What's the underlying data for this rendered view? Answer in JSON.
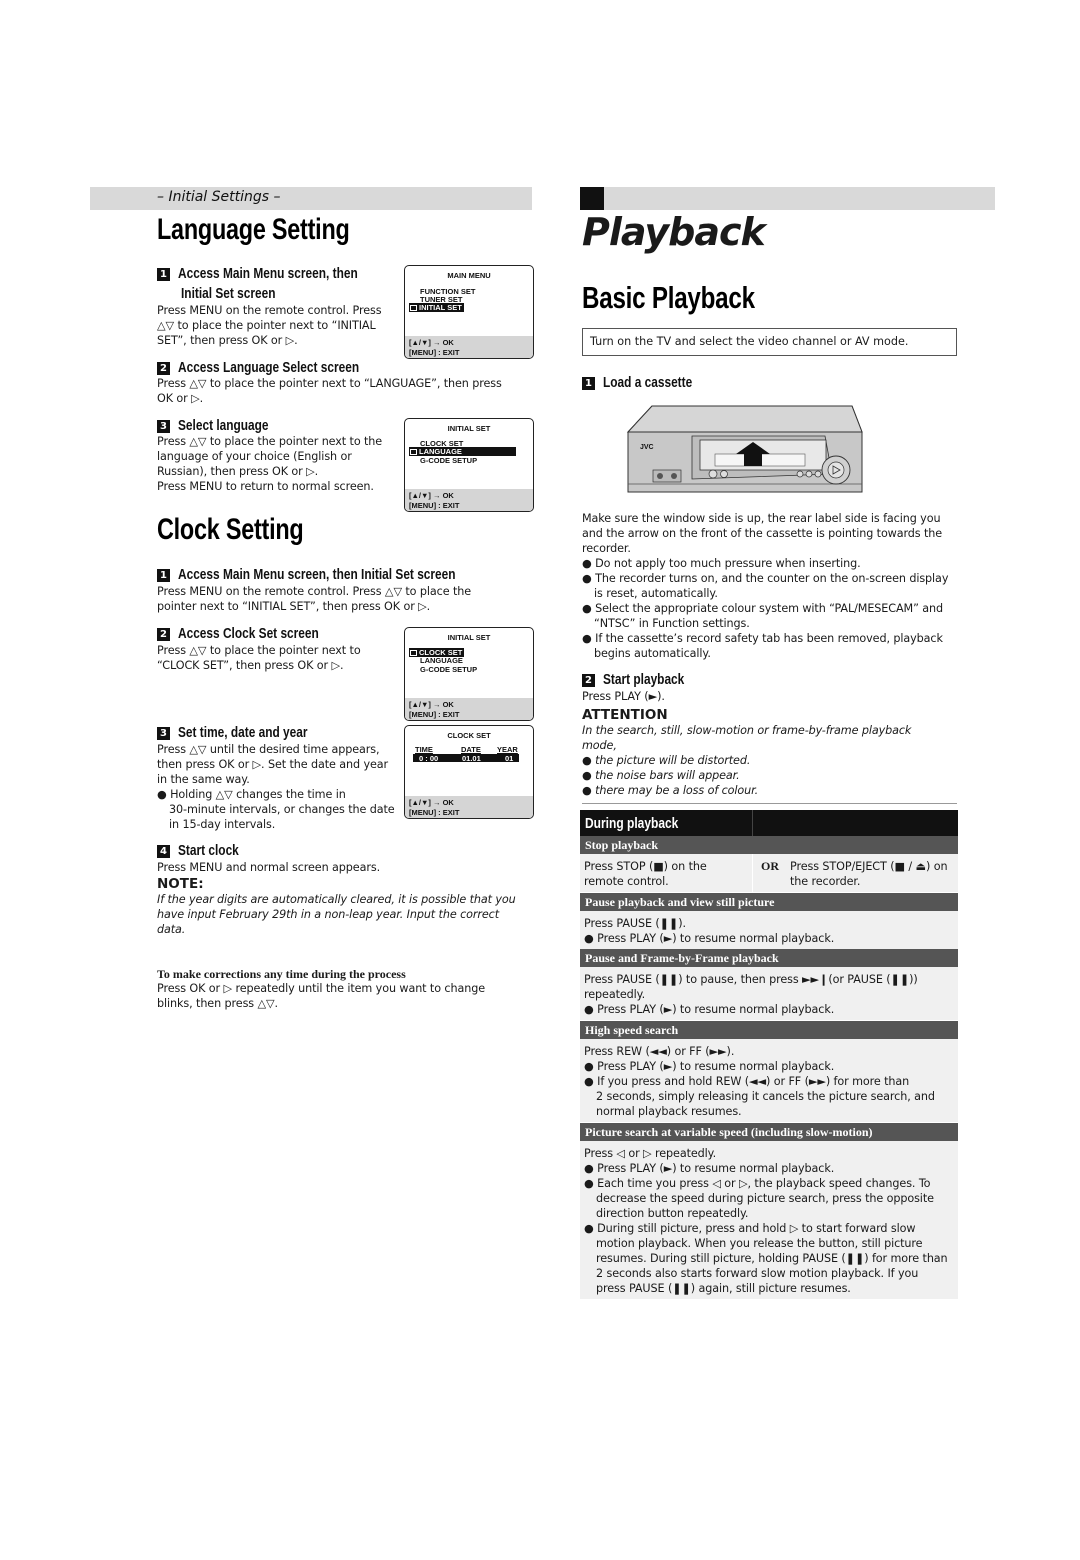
{
  "left": {
    "band_label": "– Initial Settings –",
    "language_setting": {
      "title": "Language Setting",
      "steps": [
        {
          "num": "1",
          "heading_line1": "Access Main Menu screen, then",
          "heading_line2": "Initial Set screen",
          "text_lines": [
            "Press MENU on the remote control. Press",
            "△▽ to place the pointer next to “INITIAL",
            "SET”, then press OK or ▷."
          ]
        },
        {
          "num": "2",
          "heading_line1": "Access Language Select screen",
          "text_lines": [
            "Press △▽ to place the pointer next to “LANGUAGE”, then press",
            "OK or ▷."
          ]
        },
        {
          "num": "3",
          "heading_line1": "Select language",
          "text_lines": [
            "Press △▽ to place the pointer next to the",
            "language of your choice (English or",
            "Russian), then press OK or ▷.",
            "Press MENU to return to normal screen."
          ]
        }
      ]
    },
    "clock_setting": {
      "title": "Clock Setting",
      "steps": [
        {
          "num": "1",
          "heading_line1": "Access Main Menu screen, then Initial Set screen",
          "text_lines": [
            "Press MENU on the remote control. Press △▽ to place the",
            "pointer next to “INITIAL SET”, then press OK or ▷."
          ]
        },
        {
          "num": "2",
          "heading_line1": "Access Clock Set screen",
          "text_lines": [
            "Press △▽ to place the pointer next to",
            "“CLOCK SET”, then press OK or ▷."
          ]
        },
        {
          "num": "3",
          "heading_line1": "Set time, date and year",
          "text_lines": [
            "Press △▽ until the desired time appears,",
            "then press OK or ▷. Set the date and year",
            "in the same way."
          ],
          "bullet_lines": [
            "Holding △▽ changes the time in",
            "30-minute intervals, or changes the date",
            "in 15-day intervals."
          ]
        },
        {
          "num": "4",
          "heading_line1": "Start clock",
          "text_lines": [
            "Press MENU and normal screen appears."
          ]
        }
      ],
      "note_label": "NOTE:",
      "note_lines": [
        "If the year digits are automatically cleared, it is possible that you",
        "have input February 29th in a non-leap year. Input the correct",
        "data."
      ],
      "corrections_heading": "To make corrections any time during the process",
      "corrections_lines": [
        "Press OK or ▷ repeatedly until the item you want to change",
        "blinks, then press △▽."
      ]
    },
    "osd": {
      "main_menu": {
        "title": "MAIN MENU",
        "items": [
          "FUNCTION SET",
          "TUNER SET",
          "INITIAL SET"
        ],
        "selected": "INITIAL SET",
        "foot1": "[▲/▼] → OK",
        "foot2": "[MENU] : EXIT"
      },
      "initial_set_language": {
        "title": "INITIAL SET",
        "items": [
          "CLOCK SET",
          "LANGUAGE",
          "G-CODE SETUP"
        ],
        "selected": "LANGUAGE",
        "foot1": "[▲/▼] → OK",
        "foot2": "[MENU] : EXIT"
      },
      "initial_set_clock": {
        "title": "INITIAL SET",
        "items": [
          "CLOCK SET",
          "LANGUAGE",
          "G-CODE SETUP"
        ],
        "selected": "CLOCK SET",
        "foot1": "[▲/▼] → OK",
        "foot2": "[MENU] : EXIT"
      },
      "clock_set": {
        "title": "CLOCK SET",
        "col_time": "TIME",
        "col_date": "DATE",
        "col_year": "YEAR",
        "val_time": "0 : 00",
        "val_date": "01.01",
        "val_year": "01",
        "foot1": "[▲/▼] → OK",
        "foot2": "[MENU] : EXIT"
      }
    }
  },
  "right": {
    "section_title": "Playback",
    "subtitle": "Basic Playback",
    "tv_box": "Turn on the TV and select the video channel or AV mode.",
    "vcr_brand": "JVC",
    "steps": [
      {
        "num": "1",
        "heading": "Load a cassette"
      },
      {
        "num": "2",
        "heading": "Start playback",
        "text": "Press PLAY (►)."
      }
    ],
    "cassette_text_lines": [
      "Make sure the window side is up, the rear label side is facing you",
      "and the arrow on the front of the cassette is pointing towards the",
      "recorder."
    ],
    "cassette_bullets": [
      [
        "Do not apply too much pressure when inserting."
      ],
      [
        "The recorder turns on, and the counter on the on-screen display",
        "is reset, automatically."
      ],
      [
        "Select the appropriate colour system with “PAL/MESECAM” and",
        "“NTSC” in Function settings."
      ],
      [
        "If the cassette’s record safety tab has been removed, playback",
        "begins automatically."
      ]
    ],
    "attention_label": "ATTENTION",
    "attention_lines": [
      "In the search, still, slow-motion or frame-by-frame playback",
      "mode,"
    ],
    "attention_bullets": [
      "the picture will be distorted.",
      "the noise bars will appear.",
      "there may be a loss of colour."
    ],
    "table": {
      "title": "During playback",
      "stop": {
        "heading": "Stop playback",
        "left_line1": "Press STOP (■) on the",
        "left_line2": "remote control.",
        "or": "OR",
        "right_line1": "Press STOP/EJECT (■ / ⏏) on",
        "right_line2": "the recorder."
      },
      "pause": {
        "heading": "Pause playback and view still picture",
        "line1": "Press PAUSE (❚❚).",
        "bullet1": "Press PLAY (►) to resume normal playback."
      },
      "frame": {
        "heading": "Pause and Frame-by-Frame playback",
        "line1": "Press PAUSE (❚❚) to pause, then press ►►❙(or PAUSE (❚❚))",
        "line2": "repeatedly.",
        "bullet1": "Press PLAY (►) to resume normal playback."
      },
      "search": {
        "heading": "High speed search",
        "line1": "Press REW (◄◄) or FF (►►).",
        "bullets": [
          [
            "Press PLAY (►) to resume normal playback."
          ],
          [
            "If you press and hold REW (◄◄) or FF (►►) for more than",
            "2 seconds, simply releasing it cancels the picture search, and",
            "normal playback resumes."
          ]
        ]
      },
      "variable": {
        "heading": "Picture search at variable speed (including slow-motion)",
        "line1": "Press ◁ or ▷ repeatedly.",
        "bullets": [
          [
            "Press PLAY (►) to resume normal playback."
          ],
          [
            "Each time you press ◁ or ▷, the playback speed changes. To",
            "decrease the speed during picture search, press the opposite",
            "direction button repeatedly."
          ],
          [
            "During still picture, press and hold ▷ to start forward slow",
            "motion playback. When you release the button, still picture",
            "resumes. During still picture, holding PAUSE (❚❚) for more than",
            "2 seconds also starts forward slow motion playback. If you",
            "press PAUSE (❚❚) again, still picture resumes."
          ]
        ]
      }
    }
  },
  "colors": {
    "band": "#d9d9d9",
    "table_head": "#111111",
    "sub_head": "#555555",
    "sub_body": "#f0f0f0"
  }
}
